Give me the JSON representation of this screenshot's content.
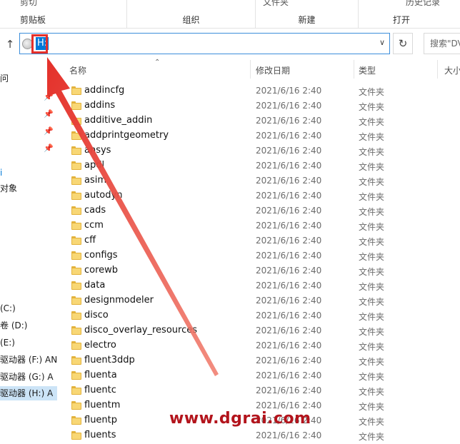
{
  "ribbon": {
    "groups": [
      {
        "label": "剪贴板",
        "top_item": "剪切"
      },
      {
        "label": "组织",
        "top_item": ""
      },
      {
        "label": "新建",
        "top_item": "文件夹"
      },
      {
        "label": "打开",
        "top_item": "历史记录"
      }
    ]
  },
  "address": {
    "path": "H:",
    "search_placeholder": "搜索\"DV"
  },
  "nav": {
    "items": [
      {
        "label": "问",
        "selected": false
      },
      {
        "label": "i",
        "selected": false
      },
      {
        "label": "对象",
        "selected": false
      },
      {
        "label": "(C:)",
        "selected": false
      },
      {
        "label": "卷 (D:)",
        "selected": false
      },
      {
        "label": "(E:)",
        "selected": false
      },
      {
        "label": "驱动器 (F:) AN",
        "selected": false
      },
      {
        "label": "驱动器 (G:) A",
        "selected": false
      },
      {
        "label": "驱动器 (H:) A",
        "selected": true
      }
    ]
  },
  "columns": {
    "name": "名称",
    "date": "修改日期",
    "type": "类型",
    "size": "大小"
  },
  "files": [
    {
      "name": "addincfg",
      "date": "2021/6/16 2:40",
      "type": "文件夹"
    },
    {
      "name": "addins",
      "date": "2021/6/16 2:40",
      "type": "文件夹"
    },
    {
      "name": "additive_addin",
      "date": "2021/6/16 2:40",
      "type": "文件夹"
    },
    {
      "name": "addprintgeometry",
      "date": "2021/6/16 2:40",
      "type": "文件夹"
    },
    {
      "name": "ansys",
      "date": "2021/6/16 2:40",
      "type": "文件夹"
    },
    {
      "name": "apdl",
      "date": "2021/6/16 2:40",
      "type": "文件夹"
    },
    {
      "name": "asim",
      "date": "2021/6/16 2:40",
      "type": "文件夹"
    },
    {
      "name": "autodyn",
      "date": "2021/6/16 2:40",
      "type": "文件夹"
    },
    {
      "name": "cads",
      "date": "2021/6/16 2:40",
      "type": "文件夹"
    },
    {
      "name": "ccm",
      "date": "2021/6/16 2:40",
      "type": "文件夹"
    },
    {
      "name": "cff",
      "date": "2021/6/16 2:40",
      "type": "文件夹"
    },
    {
      "name": "configs",
      "date": "2021/6/16 2:40",
      "type": "文件夹"
    },
    {
      "name": "corewb",
      "date": "2021/6/16 2:40",
      "type": "文件夹"
    },
    {
      "name": "data",
      "date": "2021/6/16 2:40",
      "type": "文件夹"
    },
    {
      "name": "designmodeler",
      "date": "2021/6/16 2:40",
      "type": "文件夹"
    },
    {
      "name": "disco",
      "date": "2021/6/16 2:40",
      "type": "文件夹"
    },
    {
      "name": "disco_overlay_resources",
      "date": "2021/6/16 2:40",
      "type": "文件夹"
    },
    {
      "name": "electro",
      "date": "2021/6/16 2:40",
      "type": "文件夹"
    },
    {
      "name": "fluent3ddp",
      "date": "2021/6/16 2:40",
      "type": "文件夹"
    },
    {
      "name": "fluenta",
      "date": "2021/6/16 2:40",
      "type": "文件夹"
    },
    {
      "name": "fluentc",
      "date": "2021/6/16 2:40",
      "type": "文件夹"
    },
    {
      "name": "fluentm",
      "date": "2021/6/16 2:40",
      "type": "文件夹"
    },
    {
      "name": "fluentp",
      "date": "2021/6/16 2:40",
      "type": "文件夹"
    },
    {
      "name": "fluents",
      "date": "2021/6/16 2:40",
      "type": "文件夹"
    }
  ],
  "watermark": "www.dgrai.com",
  "colors": {
    "selection": "#0078d7",
    "annotation": "#e4302a",
    "folder": "#f8d775"
  }
}
